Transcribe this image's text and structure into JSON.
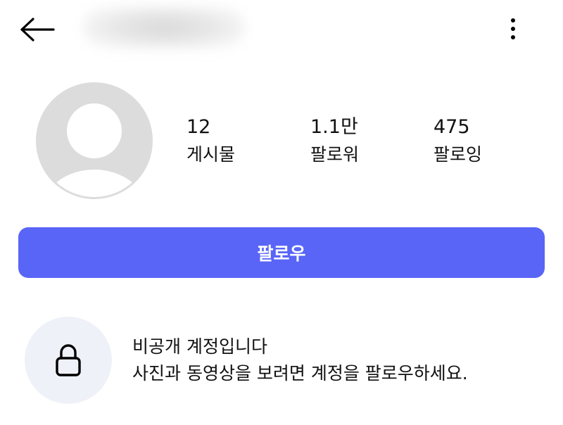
{
  "header": {
    "back_icon": "arrow-left-icon",
    "more_icon": "more-vertical-icon"
  },
  "profile": {
    "avatar_icon": "default-avatar-icon",
    "stats": {
      "posts": {
        "count": "12",
        "label": "게시물"
      },
      "followers": {
        "count": "1.1만",
        "label": "팔로워"
      },
      "following": {
        "count": "475",
        "label": "팔로잉"
      }
    }
  },
  "follow_button": {
    "label": "팔로우",
    "color": "#5865f7"
  },
  "private_notice": {
    "icon": "lock-icon",
    "title": "비공개 계정입니다",
    "description": "사진과 동영상을 보려면 계정을 팔로우하세요."
  }
}
